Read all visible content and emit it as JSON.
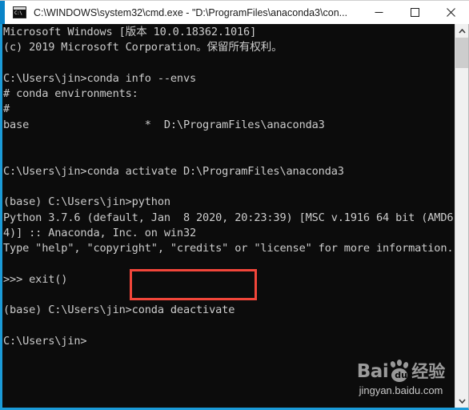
{
  "window": {
    "title": "C:\\WINDOWS\\system32\\cmd.exe - \"D:\\ProgramFiles\\anaconda3\\con...",
    "app_icon_label": "C:\\",
    "controls": {
      "minimize": "Minimize",
      "maximize": "Maximize",
      "close": "Close"
    }
  },
  "console": {
    "background_color": "#0c0c0c",
    "text_color": "#cccccc",
    "border_color": "#1b9bd8",
    "lines": [
      "Microsoft Windows [版本 10.0.18362.1016]",
      "(c) 2019 Microsoft Corporation。保留所有权利。",
      "",
      "C:\\Users\\jin>conda info --envs",
      "# conda environments:",
      "#",
      "base                  *  D:\\ProgramFiles\\anaconda3",
      "",
      "",
      "C:\\Users\\jin>conda activate D:\\ProgramFiles\\anaconda3",
      "",
      "(base) C:\\Users\\jin>python",
      "Python 3.7.6 (default, Jan  8 2020, 20:23:39) [MSC v.1916 64 bit (AMD6",
      "4)] :: Anaconda, Inc. on win32",
      "Type \"help\", \"copyright\", \"credits\" or \"license\" for more information.",
      "",
      ">>> exit()",
      "",
      "(base) C:\\Users\\jin>conda deactivate",
      "",
      "C:\\Users\\jin>"
    ]
  },
  "annotation": {
    "highlight_color": "#f2463a",
    "highlighted_command": "conda deactivate"
  },
  "watermark": {
    "brand_latin": "Bai",
    "brand_inner": "du",
    "brand_cn": "经验",
    "url": "jingyan.baidu.com"
  },
  "scrollbar": {
    "up_arrow_icon": "chevron-up-icon",
    "down_arrow_icon": "chevron-down-icon"
  }
}
